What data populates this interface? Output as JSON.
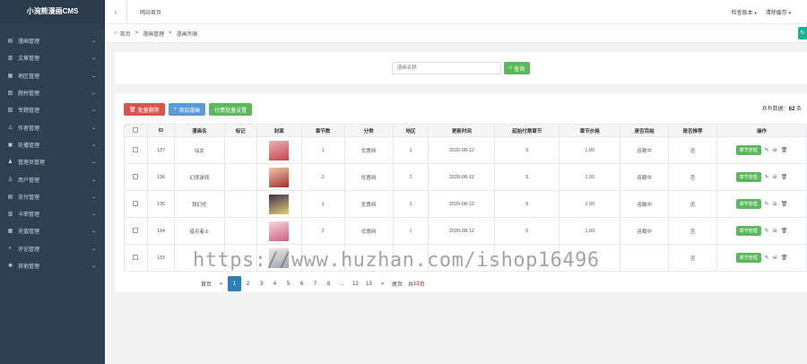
{
  "sidebar": {
    "brand": "小涴熊漫画CMS",
    "items": [
      {
        "label": "漫画管理",
        "icon": "book-icon",
        "glyph": "▤"
      },
      {
        "label": "文章管理",
        "icon": "file-icon",
        "glyph": "▥"
      },
      {
        "label": "地区管理",
        "icon": "globe-icon",
        "glyph": "▦"
      },
      {
        "label": "题材管理",
        "icon": "tag-icon",
        "glyph": "▧"
      },
      {
        "label": "专题管理",
        "icon": "folder-icon",
        "glyph": "▨"
      },
      {
        "label": "作者管理",
        "icon": "user-icon",
        "glyph": "♙"
      },
      {
        "label": "轮播管理",
        "icon": "image-icon",
        "glyph": "▣"
      },
      {
        "label": "管理员管理",
        "icon": "person-icon",
        "glyph": "♟"
      },
      {
        "label": "用户管理",
        "icon": "users-icon",
        "glyph": "♙"
      },
      {
        "label": "支付管理",
        "icon": "card-icon",
        "glyph": "▤"
      },
      {
        "label": "卡密管理",
        "icon": "key-icon",
        "glyph": "▥"
      },
      {
        "label": "充值管理",
        "icon": "wallet-icon",
        "glyph": "▦"
      },
      {
        "label": "评论管理",
        "icon": "comment-icon",
        "glyph": "◐"
      },
      {
        "label": "其他管理",
        "icon": "gear-icon",
        "glyph": "✺"
      }
    ]
  },
  "topbar": {
    "back_glyph": "‹",
    "tab": "网站首页",
    "right_items": [
      "检查版本",
      "清除缓存"
    ]
  },
  "breadcrumb": {
    "home_glyph": "⌂",
    "items": [
      "首页",
      "漫画管理",
      "漫画列表"
    ],
    "sep": ">"
  },
  "search": {
    "placeholder": "漫画名称",
    "button": "查询",
    "button_glyph": "⌕"
  },
  "toolbar": {
    "batch_delete": "批量删除",
    "add_comic": "添加漫画",
    "batch_settings": "付费批量设置",
    "total_label": "共有数据：",
    "total_value": "62",
    "total_unit": "条"
  },
  "table": {
    "headers": [
      "",
      "ID",
      "漫画名",
      "标记",
      "封面",
      "章节数",
      "分类",
      "地区",
      "更新时间",
      "起始付费章节",
      "章节价格",
      "是否完结",
      "是否推荐",
      "操作"
    ],
    "rows": [
      {
        "id": "137",
        "name": "仙女",
        "tag": "",
        "chapters": "1",
        "category": "优惠网",
        "region": "1",
        "updated": "2020-08-12",
        "pay_from": "5",
        "price": "1.00",
        "finished": "连载中",
        "recommend": "否",
        "cover": [
          "#e8b4b8",
          "#c9404a"
        ]
      },
      {
        "id": "136",
        "name": "幻境游戏",
        "tag": "",
        "chapters": "2",
        "category": "优惠网",
        "region": "1",
        "updated": "2020-08-12",
        "pay_from": "5",
        "price": "1.00",
        "finished": "连载中",
        "recommend": "否",
        "cover": [
          "#f3c6a5",
          "#a03030"
        ]
      },
      {
        "id": "135",
        "name": "我们任",
        "tag": "",
        "chapters": "1",
        "category": "优惠网",
        "region": "1",
        "updated": "2020-08-12",
        "pay_from": "5",
        "price": "1.00",
        "finished": "连载中",
        "recommend": "否",
        "cover": [
          "#3a2f4a",
          "#e6d070"
        ]
      },
      {
        "id": "134",
        "name": "借灵者士",
        "tag": "",
        "chapters": "2",
        "category": "优惠网",
        "region": "1",
        "updated": "2020-08-12",
        "pay_from": "5",
        "price": "1.00",
        "finished": "连载中",
        "recommend": "否",
        "cover": [
          "#f6d6e0",
          "#d0607a"
        ]
      },
      {
        "id": "133",
        "name": "",
        "tag": "",
        "chapters": "",
        "category": "",
        "region": "",
        "updated": "",
        "pay_from": "",
        "price": "",
        "finished": "",
        "recommend": "否",
        "cover": [
          "#efe9e2",
          "#9aa4b0"
        ]
      }
    ],
    "op_button": "章节管理",
    "op_edit_glyph": "✎",
    "op_lock_glyph": "⊖",
    "op_delete_glyph": "🗑"
  },
  "pager": {
    "first": "首页",
    "prev": "«",
    "pages": [
      "1",
      "2",
      "3",
      "4",
      "5",
      "6",
      "7",
      "8",
      "...",
      "12",
      "13"
    ],
    "next": "»",
    "last": "尾页",
    "total_prefix": "共",
    "total_pages": "13",
    "total_suffix": "页"
  },
  "watermark": "https://www.huzhan.com/ishop16496"
}
